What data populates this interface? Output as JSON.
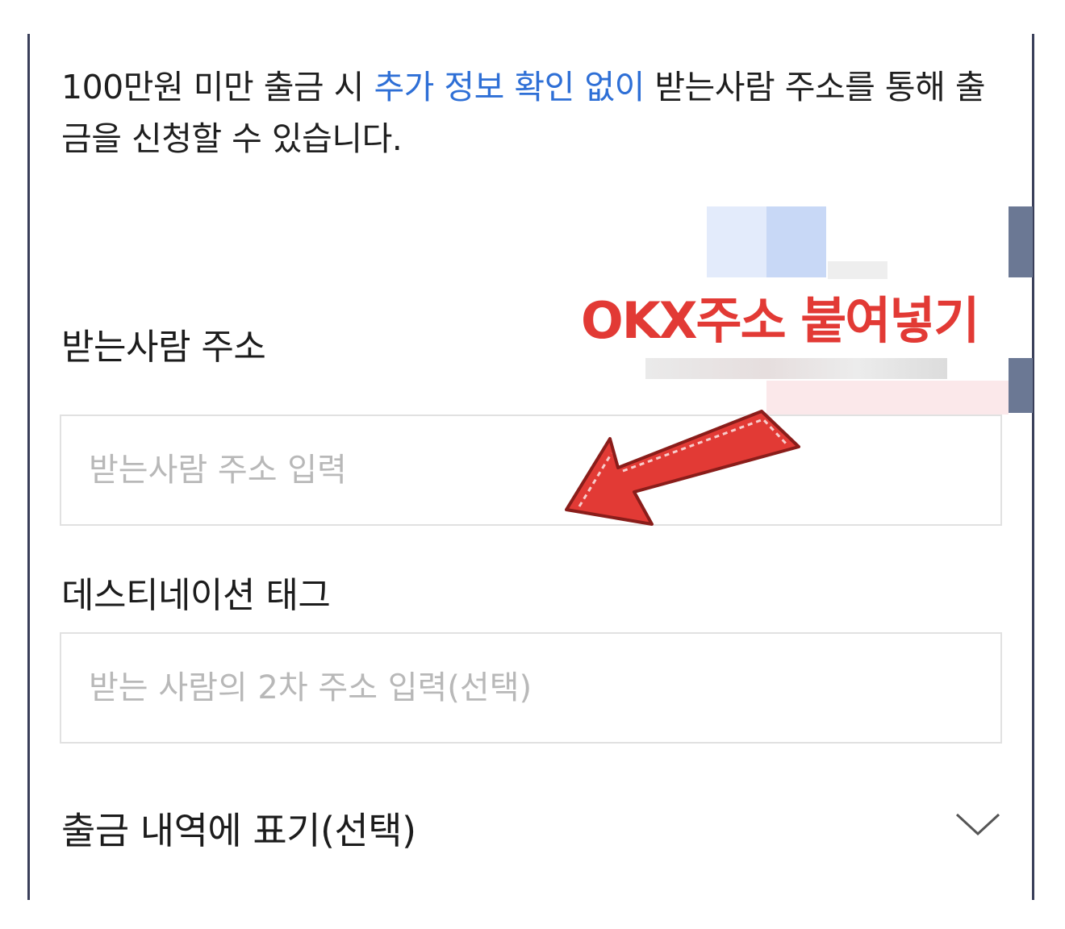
{
  "notice": {
    "part1": "100만원 미만 출금 시 ",
    "highlight": "추가 정보 확인 없이",
    "part2": " 받는사람 주소를 통해 출금을 신청할 수 있습니다."
  },
  "annotation": {
    "text": "OKX주소 붙여넣기",
    "color": "#e23a35"
  },
  "address_field": {
    "label": "받는사람 주소",
    "placeholder": "받는사람 주소 입력",
    "value": ""
  },
  "tag_field": {
    "label": "데스티네이션 태그",
    "placeholder": "받는 사람의 2차 주소 입력(선택)",
    "value": ""
  },
  "memo": {
    "label": "출금 내역에 표기(선택)",
    "icon": "chevron-down-icon"
  },
  "colors": {
    "highlight": "#2e6fd6",
    "annotation": "#e23a35",
    "frame_edge": "#3a3f5a"
  }
}
